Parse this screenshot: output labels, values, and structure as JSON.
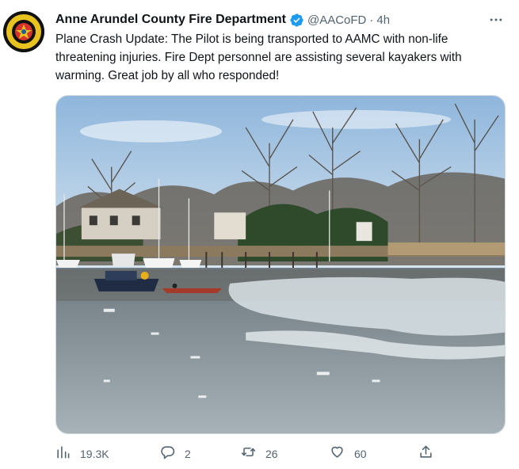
{
  "author": {
    "name": "Anne Arundel County Fire Department",
    "handle": "@AACoFD",
    "separator": "·",
    "time": "4h"
  },
  "tweet": {
    "text": "Plane Crash Update: The Pilot is being transported to AAMC with non-life threatening injuries. Fire Dept personnel are assisting several kayakers with warming. Great job by all who responded!"
  },
  "metrics": {
    "views": "19.3K",
    "replies": "2",
    "retweets": "26",
    "likes": "60"
  },
  "icons": {
    "verified": "verified-badge-icon",
    "more": "more-icon",
    "views": "views-icon",
    "reply": "reply-icon",
    "retweet": "retweet-icon",
    "like": "like-icon",
    "share": "share-icon"
  },
  "colors": {
    "verified": "#1d9bf0",
    "secondary_text": "#536471",
    "primary_text": "#0f1419"
  }
}
